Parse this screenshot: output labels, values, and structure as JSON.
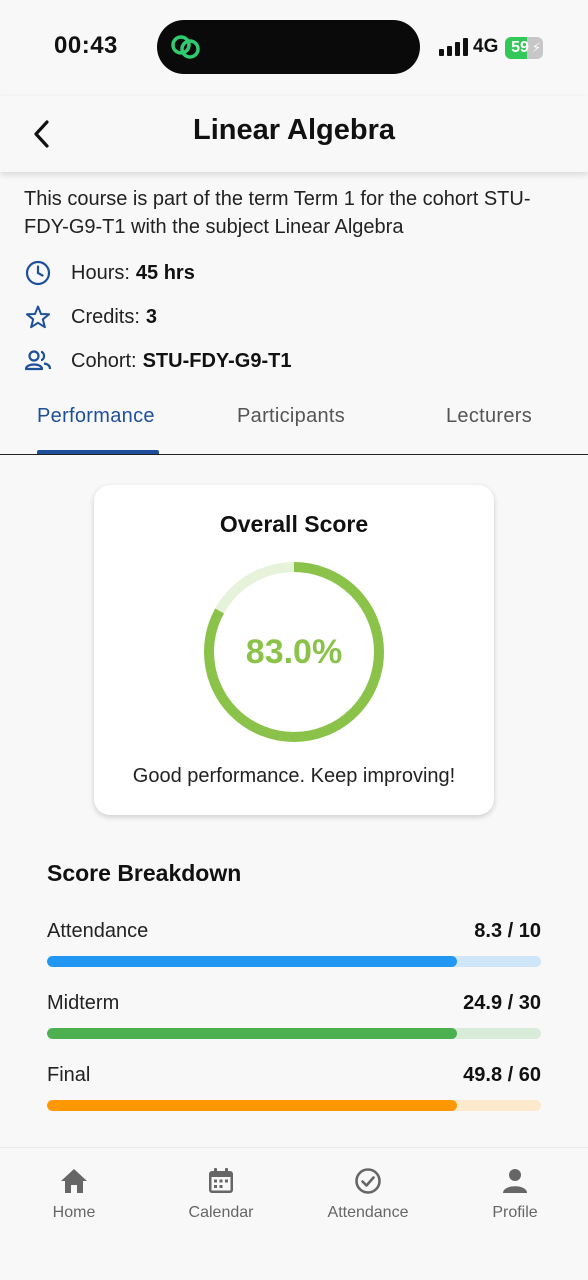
{
  "status_bar": {
    "time": "00:43",
    "network": "4G",
    "battery": "59",
    "battery_level": 0.59
  },
  "app_bar": {
    "title": "Linear Algebra",
    "back_icon": "chevron-left-icon"
  },
  "course": {
    "description": "This course is part of the term Term 1 for the cohort STU-FDY-G9-T1 with the subject Linear Algebra",
    "hours_label": "Hours:",
    "hours_value": "45 hrs",
    "credits_label": "Credits:",
    "credits_value": "3",
    "cohort_label": "Cohort:",
    "cohort_value": "STU-FDY-G9-T1"
  },
  "tabs": [
    {
      "label": "Performance",
      "active": true
    },
    {
      "label": "Participants",
      "active": false
    },
    {
      "label": "Lecturers",
      "active": false
    }
  ],
  "overall_score": {
    "title": "Overall Score",
    "percent_text": "83.0%",
    "percent": 83.0,
    "message": "Good performance. Keep improving!",
    "ring_color": "#8bc34a",
    "ring_track_color": "#e6f2da"
  },
  "breakdown": {
    "title": "Score Breakdown",
    "items": [
      {
        "label": "Attendance",
        "value_text": "8.3 / 10",
        "score": 8.3,
        "max": 10,
        "color": "#2196f3",
        "track_color": "#cfe5f8"
      },
      {
        "label": "Midterm",
        "value_text": "24.9 / 30",
        "score": 24.9,
        "max": 30,
        "color": "#4caf50",
        "track_color": "#d8ecd9"
      },
      {
        "label": "Final",
        "value_text": "49.8 / 60",
        "score": 49.8,
        "max": 60,
        "color": "#ff9800",
        "track_color": "#fde9cc"
      }
    ]
  },
  "bottom_nav": [
    {
      "label": "Home",
      "icon": "home-icon"
    },
    {
      "label": "Calendar",
      "icon": "calendar-icon"
    },
    {
      "label": "Attendance",
      "icon": "check-circle-icon"
    },
    {
      "label": "Profile",
      "icon": "person-icon"
    }
  ],
  "colors": {
    "accent": "#1d4f9a",
    "background": "#f8f8f8"
  }
}
